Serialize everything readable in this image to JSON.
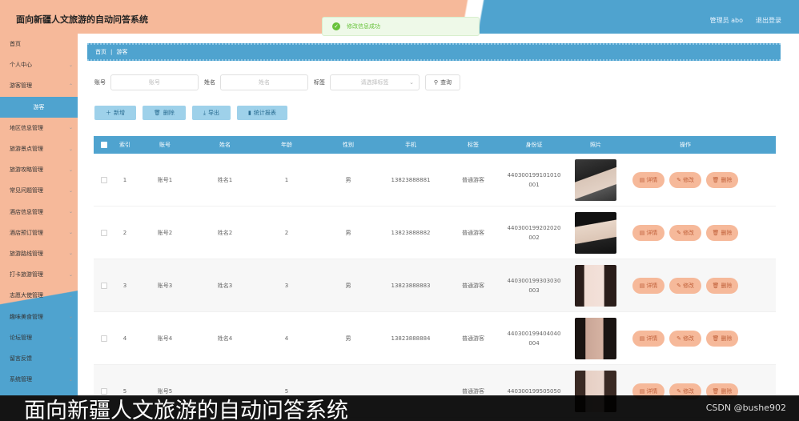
{
  "header": {
    "title": "面向新疆人文旅游的自动问答系统",
    "admin": "管理员 abo",
    "logout": "退出登录"
  },
  "toast": {
    "message": "修改信息成功"
  },
  "sidebar": {
    "items": [
      {
        "label": "首页"
      },
      {
        "label": "个人中心"
      },
      {
        "label": "游客管理"
      },
      {
        "label": "游客",
        "active": true
      },
      {
        "label": "地区信息管理"
      },
      {
        "label": "旅游景点管理"
      },
      {
        "label": "旅游攻略管理"
      },
      {
        "label": "常见问题管理"
      },
      {
        "label": "酒店信息管理"
      },
      {
        "label": "酒店预订管理"
      },
      {
        "label": "旅游路线管理"
      },
      {
        "label": "打卡旅游管理"
      },
      {
        "label": "志愿大使管理"
      },
      {
        "label": "趣味美食管理"
      },
      {
        "label": "论坛管理"
      },
      {
        "label": "留言反馈"
      },
      {
        "label": "系统管理"
      }
    ]
  },
  "breadcrumb": {
    "home": "首页",
    "sep": "|",
    "current": "游客"
  },
  "search": {
    "account_label": "账号",
    "account_placeholder": "账号",
    "name_label": "姓名",
    "name_placeholder": "姓名",
    "tag_label": "标签",
    "tag_placeholder": "请选择标签",
    "query_label": "查询"
  },
  "actions": {
    "add": "新增",
    "delete": "删除",
    "export": "导出",
    "stats": "统计报表"
  },
  "table": {
    "headers": [
      "索引",
      "账号",
      "姓名",
      "年龄",
      "性别",
      "手机",
      "标签",
      "身份证",
      "照片",
      "操作"
    ],
    "rows": [
      {
        "idx": "1",
        "account": "账号1",
        "name": "姓名1",
        "age": "1",
        "gender": "男",
        "phone": "13823888881",
        "tag": "普通游客",
        "id_line1": "440300199101010",
        "id_line2": "001"
      },
      {
        "idx": "2",
        "account": "账号2",
        "name": "姓名2",
        "age": "2",
        "gender": "男",
        "phone": "13823888882",
        "tag": "普通游客",
        "id_line1": "440300199202020",
        "id_line2": "002"
      },
      {
        "idx": "3",
        "account": "账号3",
        "name": "姓名3",
        "age": "3",
        "gender": "男",
        "phone": "13823888883",
        "tag": "普通游客",
        "id_line1": "440300199303030",
        "id_line2": "003"
      },
      {
        "idx": "4",
        "account": "账号4",
        "name": "姓名4",
        "age": "4",
        "gender": "男",
        "phone": "13823888884",
        "tag": "普通游客",
        "id_line1": "440300199404040",
        "id_line2": "004"
      },
      {
        "idx": "5",
        "account": "账号5",
        "name": "",
        "age": "5",
        "gender": "",
        "phone": "",
        "tag": "普通游客",
        "id_line1": "440300199505050",
        "id_line2": ""
      }
    ],
    "ops": {
      "detail": "详情",
      "edit": "修改",
      "delete": "删除"
    }
  },
  "caption": {
    "text": "面向新疆人文旅游的自动问答系统",
    "credit": "CSDN @bushe902"
  }
}
